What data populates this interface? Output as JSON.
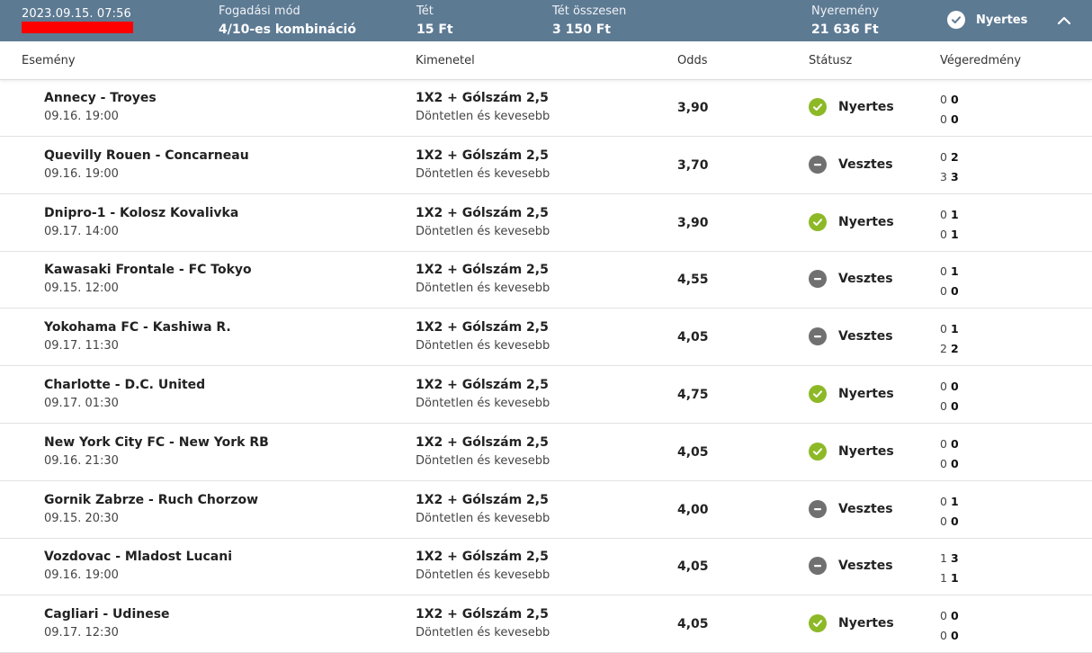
{
  "summary": {
    "datetime": "2023.09.15. 07:56",
    "bet_mode_label": "Fogadási mód",
    "bet_mode_value": "4/10-es kombináció",
    "stake_label": "Tét",
    "stake_value": "15 Ft",
    "total_stake_label": "Tét összesen",
    "total_stake_value": "3 150 Ft",
    "winnings_label": "Nyeremény",
    "winnings_value": "21 636 Ft",
    "status": "Nyertes"
  },
  "columns": {
    "event": "Esemény",
    "outcome": "Kimenetel",
    "odds": "Odds",
    "status": "Státusz",
    "result": "Végeredmény"
  },
  "rows": [
    {
      "event": "Annecy - Troyes",
      "time": "09.16. 19:00",
      "market": "1X2 + Gólszám 2,5",
      "selection": "Döntetlen és kevesebb",
      "odds": "3,90",
      "status": "Nyertes",
      "status_type": "win",
      "score": [
        [
          "0",
          "0"
        ],
        [
          "0",
          "0"
        ]
      ]
    },
    {
      "event": "Quevilly Rouen - Concarneau",
      "time": "09.16. 19:00",
      "market": "1X2 + Gólszám 2,5",
      "selection": "Döntetlen és kevesebb",
      "odds": "3,70",
      "status": "Vesztes",
      "status_type": "lose",
      "score": [
        [
          "0",
          "2"
        ],
        [
          "3",
          "3"
        ]
      ]
    },
    {
      "event": "Dnipro-1 - Kolosz Kovalivka",
      "time": "09.17. 14:00",
      "market": "1X2 + Gólszám 2,5",
      "selection": "Döntetlen és kevesebb",
      "odds": "3,90",
      "status": "Nyertes",
      "status_type": "win",
      "score": [
        [
          "0",
          "1"
        ],
        [
          "0",
          "1"
        ]
      ]
    },
    {
      "event": "Kawasaki Frontale - FC Tokyo",
      "time": "09.15. 12:00",
      "market": "1X2 + Gólszám 2,5",
      "selection": "Döntetlen és kevesebb",
      "odds": "4,55",
      "status": "Vesztes",
      "status_type": "lose",
      "score": [
        [
          "0",
          "1"
        ],
        [
          "0",
          "0"
        ]
      ]
    },
    {
      "event": "Yokohama FC - Kashiwa R.",
      "time": "09.17. 11:30",
      "market": "1X2 + Gólszám 2,5",
      "selection": "Döntetlen és kevesebb",
      "odds": "4,05",
      "status": "Vesztes",
      "status_type": "lose",
      "score": [
        [
          "0",
          "1"
        ],
        [
          "2",
          "2"
        ]
      ]
    },
    {
      "event": "Charlotte - D.C. United",
      "time": "09.17. 01:30",
      "market": "1X2 + Gólszám 2,5",
      "selection": "Döntetlen és kevesebb",
      "odds": "4,75",
      "status": "Nyertes",
      "status_type": "win",
      "score": [
        [
          "0",
          "0"
        ],
        [
          "0",
          "0"
        ]
      ]
    },
    {
      "event": "New York City FC - New York RB",
      "time": "09.16. 21:30",
      "market": "1X2 + Gólszám 2,5",
      "selection": "Döntetlen és kevesebb",
      "odds": "4,05",
      "status": "Nyertes",
      "status_type": "win",
      "score": [
        [
          "0",
          "0"
        ],
        [
          "0",
          "0"
        ]
      ]
    },
    {
      "event": "Gornik Zabrze - Ruch Chorzow",
      "time": "09.15. 20:30",
      "market": "1X2 + Gólszám 2,5",
      "selection": "Döntetlen és kevesebb",
      "odds": "4,00",
      "status": "Vesztes",
      "status_type": "lose",
      "score": [
        [
          "0",
          "1"
        ],
        [
          "0",
          "0"
        ]
      ]
    },
    {
      "event": "Vozdovac - Mladost Lucani",
      "time": "09.16. 19:00",
      "market": "1X2 + Gólszám 2,5",
      "selection": "Döntetlen és kevesebb",
      "odds": "4,05",
      "status": "Vesztes",
      "status_type": "lose",
      "score": [
        [
          "1",
          "3"
        ],
        [
          "1",
          "1"
        ]
      ]
    },
    {
      "event": "Cagliari - Udinese",
      "time": "09.17. 12:30",
      "market": "1X2 + Gólszám 2,5",
      "selection": "Döntetlen és kevesebb",
      "odds": "4,05",
      "status": "Nyertes",
      "status_type": "win",
      "score": [
        [
          "0",
          "0"
        ],
        [
          "0",
          "0"
        ]
      ]
    }
  ],
  "icons": {
    "win": "check-circle-icon",
    "lose": "minus-circle-icon",
    "collapse": "chevron-up-icon"
  },
  "colors": {
    "header_bar": "#5d7a93",
    "win": "#8db927",
    "lose": "#707070",
    "redaction": "#ff0000"
  }
}
